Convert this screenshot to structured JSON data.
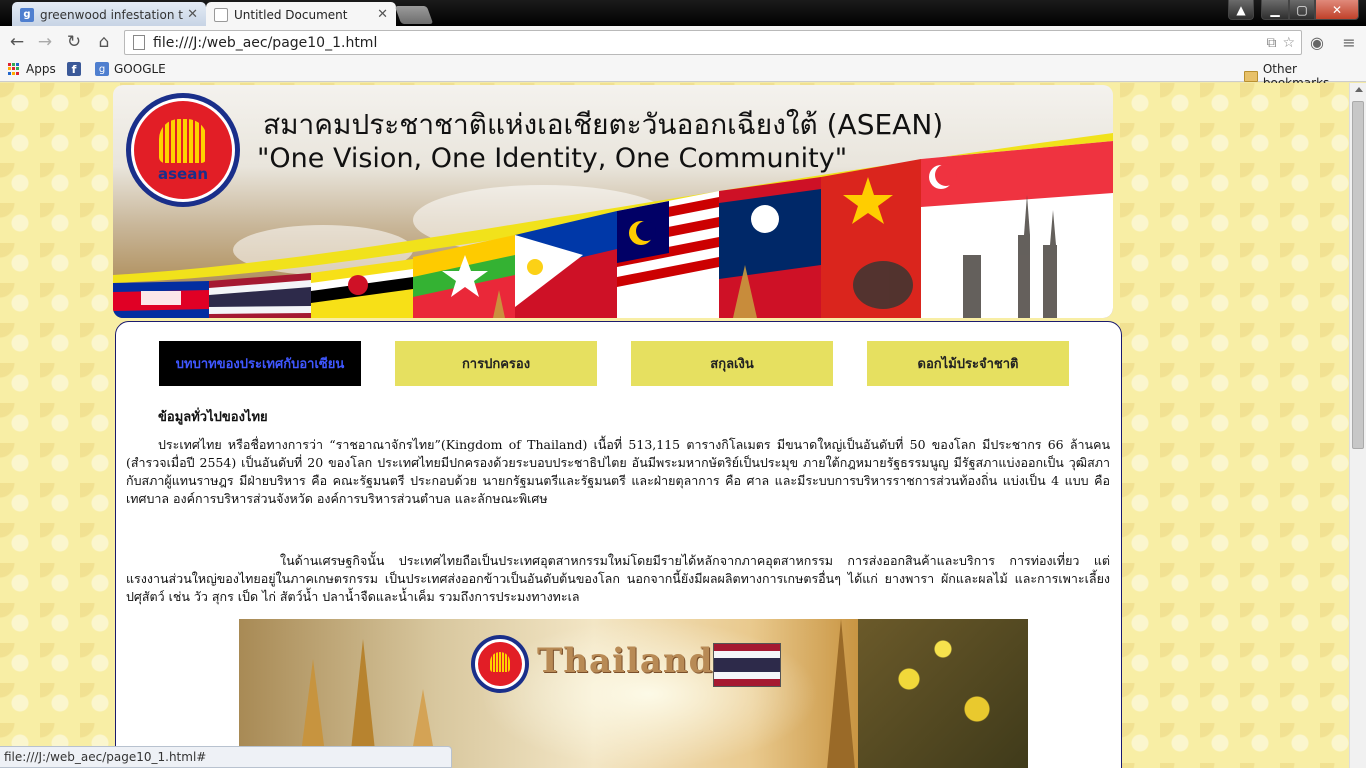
{
  "browser": {
    "tabs": [
      {
        "title": "greenwood infestation th",
        "active": false,
        "icon": "google-plus-icon"
      },
      {
        "title": "Untitled Document",
        "active": true,
        "icon": "page-icon"
      }
    ],
    "url": "file:///J:/web_aec/page10_1.html",
    "bookmarks": [
      {
        "label": "Apps",
        "icon": "apps-grid-icon"
      },
      {
        "label": "",
        "icon": "facebook-icon"
      },
      {
        "label": "GOOGLE",
        "icon": "google-plus-icon"
      }
    ],
    "other_bookmarks": "Other bookmarks",
    "status_url": "file:///J:/web_aec/page10_1.html#"
  },
  "banner": {
    "logo_text": "asean",
    "title": "สมาคมประชาชาติแห่งเอเชียตะวันออกเฉียงใต้ (ASEAN)",
    "slogan": "\"One Vision, One Identity, One Community\""
  },
  "nav": [
    {
      "label": "บทบาทของประเทศกับอาเซียน",
      "current": true
    },
    {
      "label": "การปกครอง",
      "current": false
    },
    {
      "label": "สกุลเงิน",
      "current": false
    },
    {
      "label": "ดอกไม้ประจำชาติ",
      "current": false
    }
  ],
  "content": {
    "heading": "ข้อมูลทั่วไปของไทย",
    "paragraph1": "ประเทศไทย หรือชื่อทางการว่า “ราชอาณาจักรไทย”(Kingdom of Thailand) เนื้อที่ 513,115 ตารางกิโลเมตร มีขนาดใหญ่เป็นอันดับที่ 50 ของโลก มีประชากร 66 ล้านคน (สำรวจเมื่อปี 2554) เป็นอันดับที่ 20 ของโลก ประเทศไทยมีปกครองด้วยระบอบประชาธิปไตย อันมีพระมหากษัตริย์เป็นประมุข ภายใต้กฎหมายรัฐธรรมนูญ มีรัฐสภาแบ่งออกเป็น วุฒิสภากับสภาผู้แทนราษฎร มีฝ่ายบริหาร คือ คณะรัฐมนตรี ประกอบด้วย นายกรัฐมนตรีและรัฐมนตรี และฝ่ายตุลาการ คือ ศาล และมีระบบการบริหารราชการส่วนท้องถิ่น แบ่งเป็น 4 แบบ คือ เทศบาล องค์การบริหารส่วนจังหวัด องค์การบริหารส่วนตำบล และลักษณะพิเศษ",
    "paragraph2": "ในด้านเศรษฐกิจนั้น ประเทศไทยถือเป็นประเทศอุตสาหกรรมใหม่โดยมีรายได้หลักจากภาคอุตสาหกรรม การส่งออกสินค้าและบริการ การท่องเที่ยว แต่แรงงานส่วนใหญ่ของไทยอยู่ในภาคเกษตรกรรม เป็นประเทศส่งออกข้าวเป็นอันดับต้นของโลก นอกจากนี้ยังมีผลผลิตทางการเกษตรอื่นๆ ได้แก่ ยางพารา ผักและผลไม้ และการเพาะเลี้ยงปศุสัตว์ เช่น วัว สุกร เป็ด ไก่ สัตว์น้ำ ปลาน้ำจืดและน้ำเค็ม รวมถึงการประมงทางทะเล",
    "image_caption": "Thailand"
  }
}
